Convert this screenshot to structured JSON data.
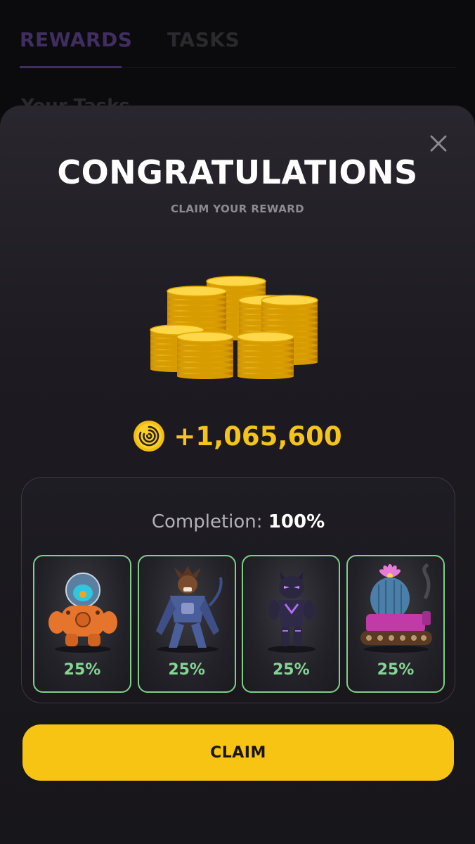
{
  "background": {
    "tabs": [
      {
        "label": "REWARDS",
        "active": true
      },
      {
        "label": "TASKS",
        "active": false
      }
    ],
    "partial_heading": "Your Tasks"
  },
  "modal": {
    "title": "CONGRATULATIONS",
    "subtitle": "CLAIM YOUR REWARD",
    "reward_amount": "+1,065,600",
    "completion_label": "Completion:",
    "completion_value": "100%",
    "cards": [
      {
        "character": "orange-robot-diver",
        "percent": "25%"
      },
      {
        "character": "blue-armored-werewolf",
        "percent": "25%"
      },
      {
        "character": "purple-panther-warrior",
        "percent": "25%"
      },
      {
        "character": "cactus-tank",
        "percent": "25%"
      }
    ],
    "claim_label": "CLAIM"
  },
  "colors": {
    "accent_gold": "#f6c31c",
    "claim_button": "#f8c413",
    "card_border": "#7fcf8a",
    "tab_active": "#3f2e5f"
  }
}
